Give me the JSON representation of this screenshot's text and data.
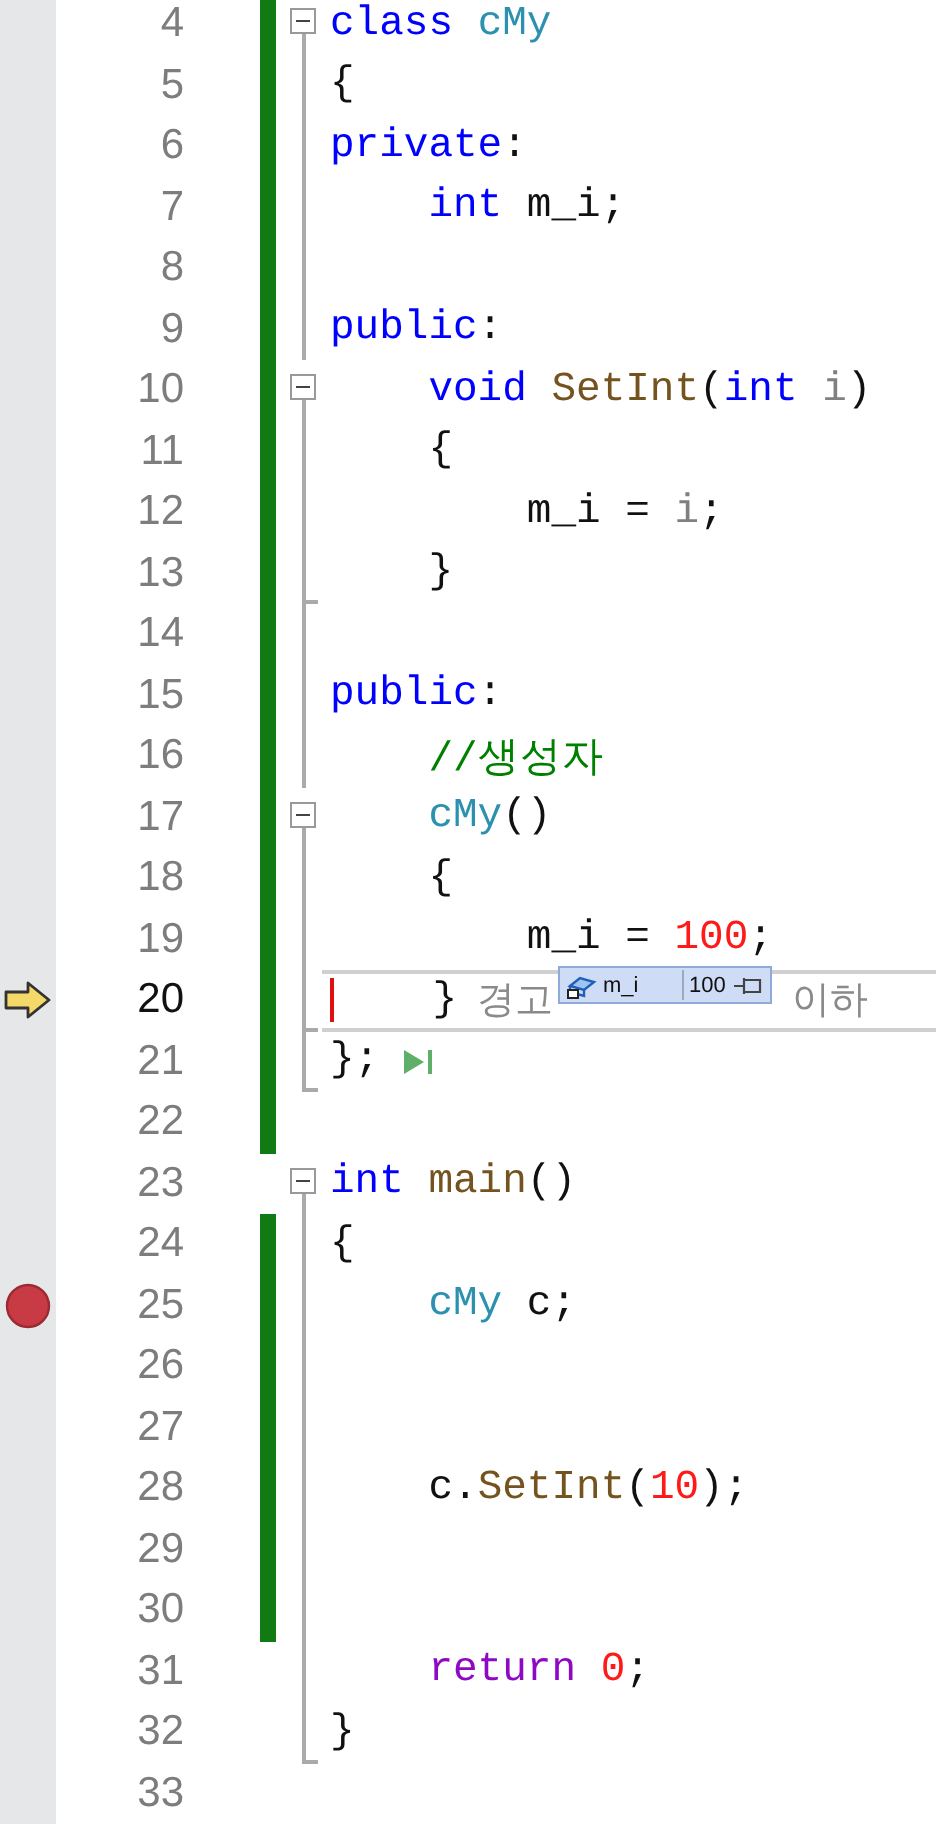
{
  "editor": {
    "lines": [
      {
        "number": "4",
        "changed": true,
        "expanded": true,
        "tokens": [
          {
            "kind": "kw",
            "text": "class"
          },
          {
            "kind": "type",
            "text": " cMy"
          }
        ]
      },
      {
        "number": "5",
        "changed": true,
        "in_block": true,
        "tokens": [
          {
            "kind": "plain",
            "text": "{"
          }
        ]
      },
      {
        "number": "6",
        "changed": true,
        "in_block": true,
        "tokens": [
          {
            "kind": "kw",
            "text": "private"
          },
          {
            "kind": "plain",
            "text": ":"
          }
        ]
      },
      {
        "number": "7",
        "changed": true,
        "in_block": true,
        "tokens": [
          {
            "kind": "kw",
            "text": "    int"
          },
          {
            "kind": "plain",
            "text": " m_i;"
          }
        ]
      },
      {
        "number": "8",
        "changed": true,
        "in_block": true
      },
      {
        "number": "9",
        "changed": true,
        "in_block": true,
        "tokens": [
          {
            "kind": "kw",
            "text": "public"
          },
          {
            "kind": "plain",
            "text": ":"
          }
        ]
      },
      {
        "number": "10",
        "changed": true,
        "expanded": true,
        "tokens": [
          {
            "kind": "kw",
            "text": "    void"
          },
          {
            "kind": "fn",
            "text": " SetInt"
          },
          {
            "kind": "plain",
            "text": "("
          },
          {
            "kind": "kw",
            "text": "int"
          },
          {
            "kind": "param",
            "text": " i"
          },
          {
            "kind": "plain",
            "text": ")"
          }
        ]
      },
      {
        "number": "11",
        "changed": true,
        "in_block": true,
        "tokens": [
          {
            "kind": "plain",
            "text": "    {"
          }
        ]
      },
      {
        "number": "12",
        "changed": true,
        "in_block": true,
        "tokens": [
          {
            "kind": "plain",
            "text": "        m_i = "
          },
          {
            "kind": "param",
            "text": "i"
          },
          {
            "kind": "plain",
            "text": ";"
          }
        ]
      },
      {
        "number": "13",
        "changed": true,
        "in_block": true,
        "block_end": true,
        "tokens": [
          {
            "kind": "plain",
            "text": "    }"
          }
        ]
      },
      {
        "number": "14",
        "changed": true,
        "in_block": true
      },
      {
        "number": "15",
        "changed": true,
        "in_block": true,
        "tokens": [
          {
            "kind": "kw",
            "text": "public"
          },
          {
            "kind": "plain",
            "text": ":"
          }
        ]
      },
      {
        "number": "16",
        "changed": true,
        "in_block": true,
        "tokens": [
          {
            "kind": "comment",
            "text": "    //생성자"
          }
        ]
      },
      {
        "number": "17",
        "changed": true,
        "expanded": true,
        "tokens": [
          {
            "kind": "type",
            "text": "    cMy"
          },
          {
            "kind": "plain",
            "text": "()"
          }
        ]
      },
      {
        "number": "18",
        "changed": true,
        "in_block": true,
        "tokens": [
          {
            "kind": "plain",
            "text": "    {"
          }
        ]
      },
      {
        "number": "19",
        "changed": true,
        "in_block": true,
        "tokens": [
          {
            "kind": "plain",
            "text": "        m_i = "
          },
          {
            "kind": "num",
            "text": "100"
          },
          {
            "kind": "plain",
            "text": ";"
          }
        ]
      },
      {
        "number": "20",
        "changed": true,
        "in_block": true,
        "block_end": true,
        "current": true,
        "tokens": [
          {
            "kind": "plain",
            "text": "    }"
          }
        ],
        "hint_before": "경고",
        "datatip": {
          "name": "m_i",
          "value": "100"
        },
        "hint_after": "이하"
      },
      {
        "number": "21",
        "changed": true,
        "in_block": true,
        "block_end": true,
        "run_to_click": true,
        "tokens": [
          {
            "kind": "plain",
            "text": "};"
          }
        ]
      },
      {
        "number": "22",
        "changed": true
      },
      {
        "number": "23",
        "changed": false,
        "expanded": true,
        "tokens": [
          {
            "kind": "kw",
            "text": "int"
          },
          {
            "kind": "fn",
            "text": " main"
          },
          {
            "kind": "plain",
            "text": "()"
          }
        ]
      },
      {
        "number": "24",
        "changed": true,
        "in_block": true,
        "tokens": [
          {
            "kind": "plain",
            "text": "{"
          }
        ]
      },
      {
        "number": "25",
        "changed": true,
        "in_block": true,
        "breakpoint": true,
        "tokens": [
          {
            "kind": "type",
            "text": "    cMy"
          },
          {
            "kind": "plain",
            "text": " c;"
          }
        ]
      },
      {
        "number": "26",
        "changed": true,
        "in_block": true
      },
      {
        "number": "27",
        "changed": true,
        "in_block": true
      },
      {
        "number": "28",
        "changed": true,
        "in_block": true,
        "tokens": [
          {
            "kind": "plain",
            "text": "    c."
          },
          {
            "kind": "fn",
            "text": "SetInt"
          },
          {
            "kind": "plain",
            "text": "("
          },
          {
            "kind": "num",
            "text": "10"
          },
          {
            "kind": "plain",
            "text": ");"
          }
        ]
      },
      {
        "number": "29",
        "changed": true,
        "in_block": true
      },
      {
        "number": "30",
        "changed": true,
        "in_block": true
      },
      {
        "number": "31",
        "changed": false,
        "in_block": true,
        "tokens": [
          {
            "kind": "ret",
            "text": "    return"
          },
          {
            "kind": "num",
            "text": " 0"
          },
          {
            "kind": "plain",
            "text": ";"
          }
        ]
      },
      {
        "number": "32",
        "changed": false,
        "in_block": true,
        "block_end": true,
        "tokens": [
          {
            "kind": "plain",
            "text": "}"
          }
        ]
      },
      {
        "number": "33",
        "changed": false
      }
    ]
  }
}
